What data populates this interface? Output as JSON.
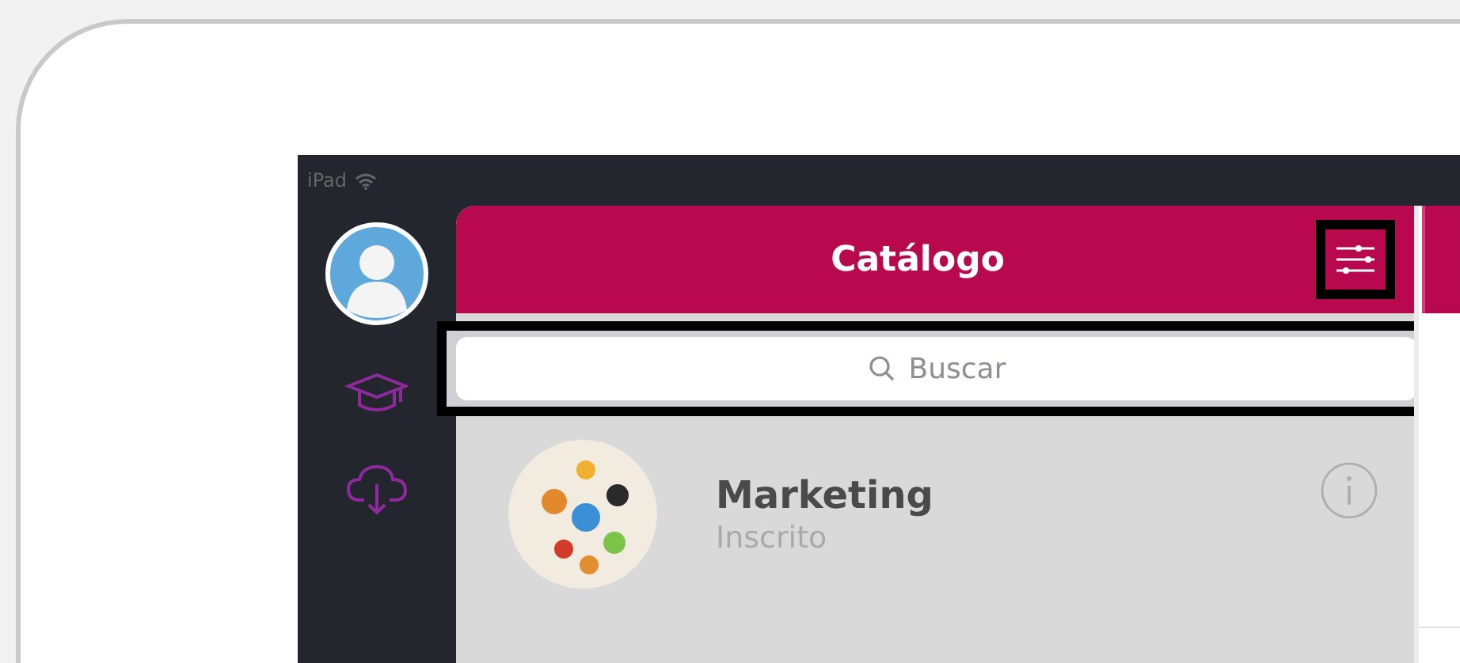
{
  "status_bar": {
    "device": "iPad"
  },
  "header": {
    "title": "Catálogo"
  },
  "search": {
    "placeholder": "Buscar"
  },
  "courses": [
    {
      "title": "Marketing",
      "status": "Inscrito"
    }
  ]
}
